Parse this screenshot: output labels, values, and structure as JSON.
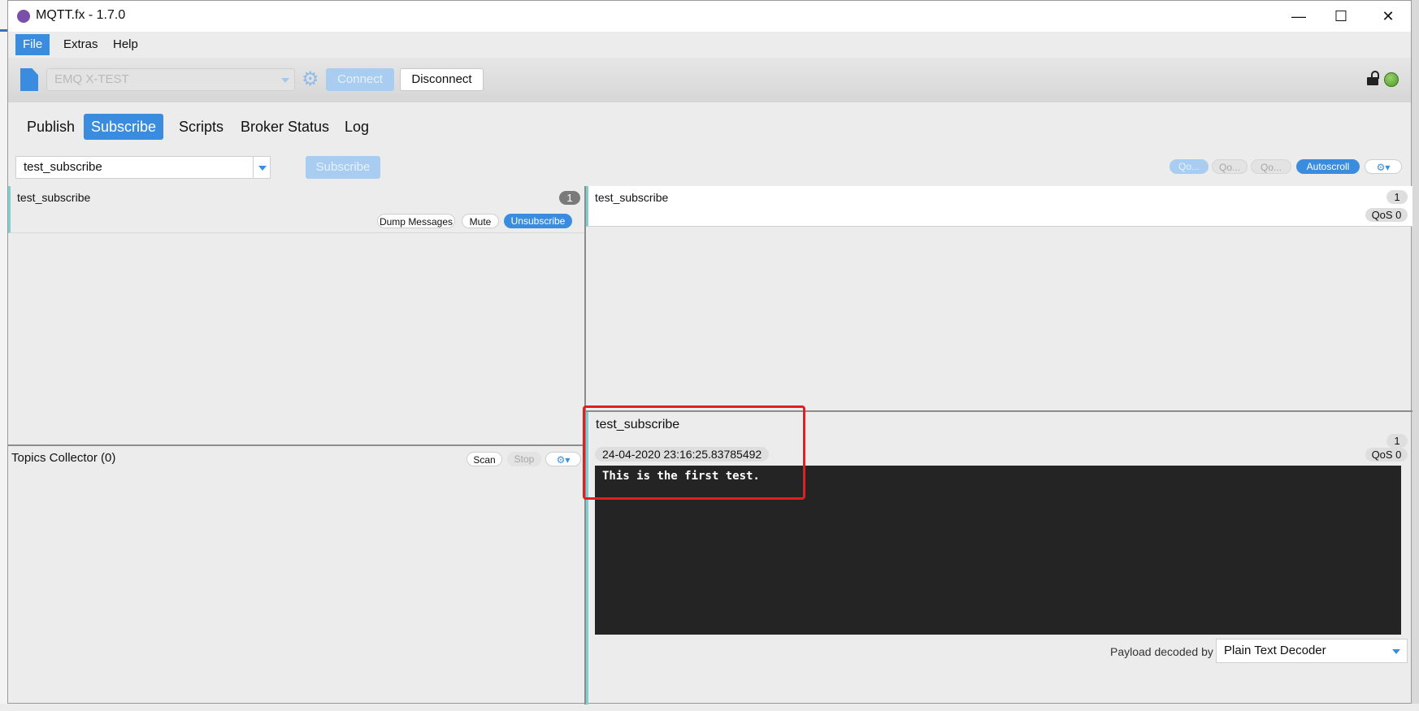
{
  "window": {
    "title": "MQTT.fx - 1.7.0"
  },
  "menu": [
    "File",
    "Extras",
    "Help"
  ],
  "toolbar": {
    "profile": "EMQ X-TEST",
    "connect_label": "Connect",
    "disconnect_label": "Disconnect",
    "connection_status_color": "#4a9a2a"
  },
  "tabs": [
    "Publish",
    "Subscribe",
    "Scripts",
    "Broker Status",
    "Log"
  ],
  "subscribe_bar": {
    "topic_value": "test_subscribe",
    "subscribe_label": "Subscribe",
    "qos_buttons": [
      "Qo...",
      "Qo...",
      "Qo..."
    ],
    "autoscroll_label": "Autoscroll"
  },
  "subscriptions": [
    {
      "topic": "test_subscribe",
      "count": "1",
      "actions": [
        "Dump Messages",
        "Mute",
        "Unsubscribe"
      ]
    }
  ],
  "topics_collector": {
    "title": "Topics Collector (0)",
    "scan_label": "Scan",
    "stop_label": "Stop"
  },
  "messages": [
    {
      "topic": "test_subscribe",
      "count": "1",
      "qos": "QoS 0"
    }
  ],
  "detail": {
    "topic": "test_subscribe",
    "count": "1",
    "timestamp": "24-04-2020  23:16:25.83785492",
    "qos": "QoS 0",
    "payload": "This is the first test.",
    "decoder_label": "Payload decoded by",
    "decoder": "Plain Text Decoder"
  },
  "colors": {
    "accent": "#3a8dde",
    "highlight": "#e02020"
  }
}
